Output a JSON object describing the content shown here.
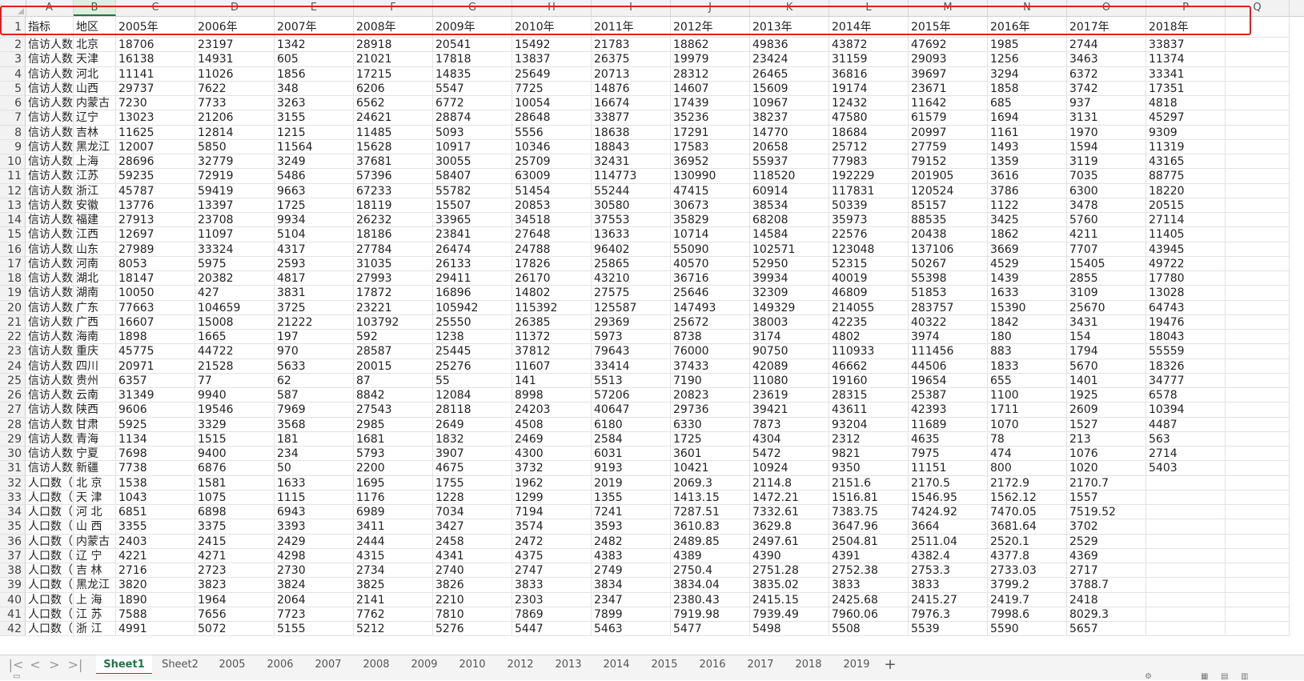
{
  "columns": [
    "A",
    "B",
    "C",
    "D",
    "E",
    "F",
    "G",
    "H",
    "I",
    "J",
    "K",
    "L",
    "M",
    "N",
    "O",
    "P",
    "Q"
  ],
  "selected_column": "B",
  "rows": [
    [
      "指标",
      "地区",
      "2005年",
      "2006年",
      "2007年",
      "2008年",
      "2009年",
      "2010年",
      "2011年",
      "2012年",
      "2013年",
      "2014年",
      "2015年",
      "2016年",
      "2017年",
      "2018年"
    ],
    [
      "信访人数",
      "北京",
      "18706",
      "23197",
      "1342",
      "28918",
      "20541",
      "15492",
      "21783",
      "18862",
      "49836",
      "43872",
      "47692",
      "1985",
      "2744",
      "33837"
    ],
    [
      "信访人数",
      "天津",
      "16138",
      "14931",
      "605",
      "21021",
      "17818",
      "13837",
      "26375",
      "19979",
      "23424",
      "31159",
      "29093",
      "1256",
      "3463",
      "11374"
    ],
    [
      "信访人数",
      "河北",
      "11141",
      "11026",
      "1856",
      "17215",
      "14835",
      "25649",
      "20713",
      "28312",
      "26465",
      "36816",
      "39697",
      "3294",
      "6372",
      "33341"
    ],
    [
      "信访人数",
      "山西",
      "29737",
      "7622",
      "348",
      "6206",
      "5547",
      "7725",
      "14876",
      "14607",
      "15609",
      "19174",
      "23671",
      "1858",
      "3742",
      "17351"
    ],
    [
      "信访人数",
      "内蒙古",
      "7230",
      "7733",
      "3263",
      "6562",
      "6772",
      "10054",
      "16674",
      "17439",
      "10967",
      "12432",
      "11642",
      "685",
      "937",
      "4818"
    ],
    [
      "信访人数",
      "辽宁",
      "13023",
      "21206",
      "3155",
      "24621",
      "28874",
      "28648",
      "33877",
      "35236",
      "38237",
      "47580",
      "61579",
      "1694",
      "3131",
      "45297"
    ],
    [
      "信访人数",
      "吉林",
      "11625",
      "12814",
      "1215",
      "11485",
      "5093",
      "5556",
      "18638",
      "17291",
      "14770",
      "18684",
      "20997",
      "1161",
      "1970",
      "9309"
    ],
    [
      "信访人数",
      "黑龙江",
      "12007",
      "5850",
      "11564",
      "15628",
      "10917",
      "10346",
      "18843",
      "17583",
      "20658",
      "25712",
      "27759",
      "1493",
      "1594",
      "11319"
    ],
    [
      "信访人数",
      "上海",
      "28696",
      "32779",
      "3249",
      "37681",
      "30055",
      "25709",
      "32431",
      "36952",
      "55937",
      "77983",
      "79152",
      "1359",
      "3119",
      "43165"
    ],
    [
      "信访人数",
      "江苏",
      "59235",
      "72919",
      "5486",
      "57396",
      "58407",
      "63009",
      "114773",
      "130990",
      "118520",
      "192229",
      "201905",
      "3616",
      "7035",
      "88775"
    ],
    [
      "信访人数",
      "浙江",
      "45787",
      "59419",
      "9663",
      "67233",
      "55782",
      "51454",
      "55244",
      "47415",
      "60914",
      "117831",
      "120524",
      "3786",
      "6300",
      "18220"
    ],
    [
      "信访人数",
      "安徽",
      "13776",
      "13397",
      "1725",
      "18119",
      "15507",
      "20853",
      "30580",
      "30673",
      "38534",
      "50339",
      "85157",
      "1122",
      "3478",
      "20515"
    ],
    [
      "信访人数",
      "福建",
      "27913",
      "23708",
      "9934",
      "26232",
      "33965",
      "34518",
      "37553",
      "35829",
      "68208",
      "35973",
      "88535",
      "3425",
      "5760",
      "27114"
    ],
    [
      "信访人数",
      "江西",
      "12697",
      "11097",
      "5104",
      "18186",
      "23841",
      "27648",
      "13633",
      "10714",
      "14584",
      "22576",
      "20438",
      "1862",
      "4211",
      "11405"
    ],
    [
      "信访人数",
      "山东",
      "27989",
      "33324",
      "4317",
      "27784",
      "26474",
      "24788",
      "96402",
      "55090",
      "102571",
      "123048",
      "137106",
      "3669",
      "7707",
      "43945"
    ],
    [
      "信访人数",
      "河南",
      "8053",
      "5975",
      "2593",
      "31035",
      "26133",
      "17826",
      "25865",
      "40570",
      "52950",
      "52315",
      "50267",
      "4529",
      "15405",
      "49722"
    ],
    [
      "信访人数",
      "湖北",
      "18147",
      "20382",
      "4817",
      "27993",
      "29411",
      "26170",
      "43210",
      "36716",
      "39934",
      "40019",
      "55398",
      "1439",
      "2855",
      "17780"
    ],
    [
      "信访人数",
      "湖南",
      "10050",
      "427",
      "3831",
      "17872",
      "16896",
      "14802",
      "27575",
      "25646",
      "32309",
      "46809",
      "51853",
      "1633",
      "3109",
      "13028"
    ],
    [
      "信访人数",
      "广东",
      "77663",
      "104659",
      "3725",
      "23221",
      "105942",
      "115392",
      "125587",
      "147493",
      "149329",
      "214055",
      "283757",
      "15390",
      "25670",
      "64743"
    ],
    [
      "信访人数",
      "广西",
      "16607",
      "15008",
      "21222",
      "103792",
      "25550",
      "26385",
      "29369",
      "25672",
      "38003",
      "42235",
      "40322",
      "1842",
      "3431",
      "19476"
    ],
    [
      "信访人数",
      "海南",
      "1898",
      "1665",
      "197",
      "592",
      "1238",
      "11372",
      "5973",
      "8738",
      "3174",
      "4802",
      "3974",
      "180",
      "154",
      "18043"
    ],
    [
      "信访人数",
      "重庆",
      "45775",
      "44722",
      "970",
      "28587",
      "25445",
      "37812",
      "79643",
      "76000",
      "90750",
      "110933",
      "111456",
      "883",
      "1794",
      "55559"
    ],
    [
      "信访人数",
      "四川",
      "20971",
      "21528",
      "5633",
      "20015",
      "25276",
      "11607",
      "33414",
      "37433",
      "42089",
      "46662",
      "44506",
      "1833",
      "5670",
      "18326"
    ],
    [
      "信访人数",
      "贵州",
      "6357",
      "77",
      "62",
      "87",
      "55",
      "141",
      "5513",
      "7190",
      "11080",
      "19160",
      "19654",
      "655",
      "1401",
      "34777"
    ],
    [
      "信访人数",
      "云南",
      "31349",
      "9940",
      "587",
      "8842",
      "12084",
      "8998",
      "57206",
      "20823",
      "23619",
      "28315",
      "25387",
      "1100",
      "1925",
      "6578"
    ],
    [
      "信访人数",
      "陕西",
      "9606",
      "19546",
      "7969",
      "27543",
      "28118",
      "24203",
      "40647",
      "29736",
      "39421",
      "43611",
      "42393",
      "1711",
      "2609",
      "10394"
    ],
    [
      "信访人数",
      "甘肃",
      "5925",
      "3329",
      "3568",
      "2985",
      "2649",
      "4508",
      "6180",
      "6330",
      "7873",
      "93204",
      "11689",
      "1070",
      "1527",
      "4487"
    ],
    [
      "信访人数",
      "青海",
      "1134",
      "1515",
      "181",
      "1681",
      "1832",
      "2469",
      "2584",
      "1725",
      "4304",
      "2312",
      "4635",
      "78",
      "213",
      "563"
    ],
    [
      "信访人数",
      "宁夏",
      "7698",
      "9400",
      "234",
      "5793",
      "3907",
      "4300",
      "6031",
      "3601",
      "5472",
      "9821",
      "7975",
      "474",
      "1076",
      "2714"
    ],
    [
      "信访人数",
      "新疆",
      "7738",
      "6876",
      "50",
      "2200",
      "4675",
      "3732",
      "9193",
      "10421",
      "10924",
      "9350",
      "11151",
      "800",
      "1020",
      "5403"
    ],
    [
      "人口数（",
      "北 京",
      "1538",
      "1581",
      "1633",
      "1695",
      "1755",
      "1962",
      "2019",
      "2069.3",
      "2114.8",
      "2151.6",
      "2170.5",
      "2172.9",
      "2170.7",
      ""
    ],
    [
      "人口数（",
      "天 津",
      "1043",
      "1075",
      "1115",
      "1176",
      "1228",
      "1299",
      "1355",
      "1413.15",
      "1472.21",
      "1516.81",
      "1546.95",
      "1562.12",
      "1557",
      ""
    ],
    [
      "人口数（",
      "河 北",
      "6851",
      "6898",
      "6943",
      "6989",
      "7034",
      "7194",
      "7241",
      "7287.51",
      "7332.61",
      "7383.75",
      "7424.92",
      "7470.05",
      "7519.52",
      ""
    ],
    [
      "人口数（",
      "山 西",
      "3355",
      "3375",
      "3393",
      "3411",
      "3427",
      "3574",
      "3593",
      "3610.83",
      "3629.8",
      "3647.96",
      "3664",
      "3681.64",
      "3702",
      ""
    ],
    [
      "人口数（",
      "内蒙古",
      "2403",
      "2415",
      "2429",
      "2444",
      "2458",
      "2472",
      "2482",
      "2489.85",
      "2497.61",
      "2504.81",
      "2511.04",
      "2520.1",
      "2529",
      ""
    ],
    [
      "人口数（",
      "辽 宁",
      "4221",
      "4271",
      "4298",
      "4315",
      "4341",
      "4375",
      "4383",
      "4389",
      "4390",
      "4391",
      "4382.4",
      "4377.8",
      "4369",
      ""
    ],
    [
      "人口数（",
      "吉 林",
      "2716",
      "2723",
      "2730",
      "2734",
      "2740",
      "2747",
      "2749",
      "2750.4",
      "2751.28",
      "2752.38",
      "2753.3",
      "2733.03",
      "2717",
      ""
    ],
    [
      "人口数（",
      "黑龙江",
      "3820",
      "3823",
      "3824",
      "3825",
      "3826",
      "3833",
      "3834",
      "3834.04",
      "3835.02",
      "3833",
      "3833",
      "3799.2",
      "3788.7",
      ""
    ],
    [
      "人口数（",
      "上 海",
      "1890",
      "1964",
      "2064",
      "2141",
      "2210",
      "2303",
      "2347",
      "2380.43",
      "2415.15",
      "2425.68",
      "2415.27",
      "2419.7",
      "2418",
      ""
    ],
    [
      "人口数（",
      "江 苏",
      "7588",
      "7656",
      "7723",
      "7762",
      "7810",
      "7869",
      "7899",
      "7919.98",
      "7939.49",
      "7960.06",
      "7976.3",
      "7998.6",
      "8029.3",
      ""
    ],
    [
      "人口数（",
      "浙 江",
      "4991",
      "5072",
      "5155",
      "5212",
      "5276",
      "5447",
      "5463",
      "5477",
      "5498",
      "5508",
      "5539",
      "5590",
      "5657",
      ""
    ]
  ],
  "sheet_tabs": [
    "Sheet1",
    "Sheet2",
    "2005",
    "2006",
    "2007",
    "2008",
    "2009",
    "2010",
    "2012",
    "2013",
    "2014",
    "2015",
    "2016",
    "2017",
    "2018",
    "2019"
  ],
  "active_tab": "Sheet1",
  "nav_buttons": [
    "|<",
    "<",
    ">",
    ">|"
  ],
  "add_tab_label": "+",
  "accent_color": "#217346",
  "highlight_color": "#e02020"
}
